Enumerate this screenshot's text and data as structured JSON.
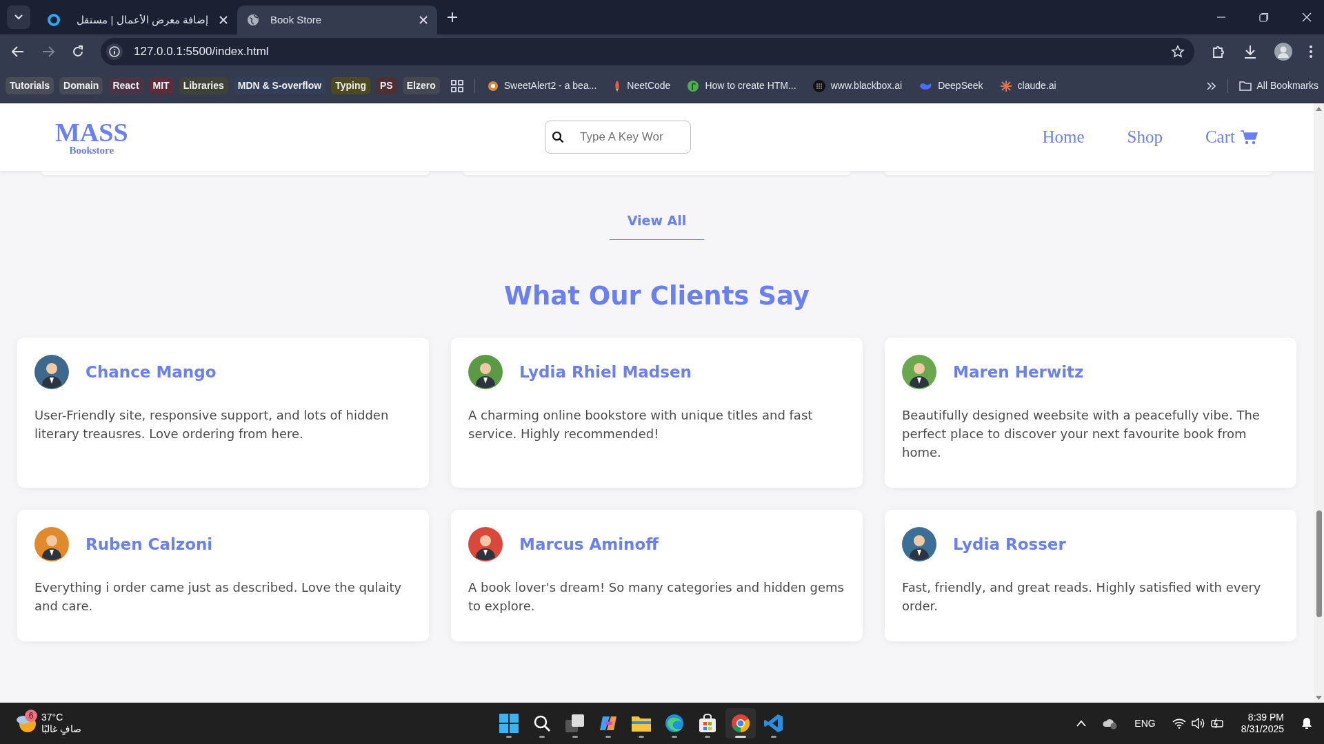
{
  "browser": {
    "tabs": [
      {
        "title": "إضافة معرض الأعمال | مستقل",
        "kind": "ring",
        "selected": false
      },
      {
        "title": "Book Store",
        "kind": "globe",
        "selected": true
      }
    ],
    "address": "127.0.0.1:5500/index.html",
    "bookmarks": [
      {
        "label": "Tutorials",
        "kind": "chip",
        "color": "#4a4d55"
      },
      {
        "label": "Domain",
        "kind": "chip",
        "color": "#474b55"
      },
      {
        "label": "React",
        "kind": "chip",
        "color": "#4b3446"
      },
      {
        "label": "MIT",
        "kind": "chip",
        "color": "#5a2c3c"
      },
      {
        "label": "Libraries",
        "kind": "chip",
        "color": "#3f4236"
      },
      {
        "label": "MDN & S-overflow",
        "kind": "chip",
        "color": "#333f59"
      },
      {
        "label": "Typing",
        "kind": "chip",
        "color": "#4b4a20"
      },
      {
        "label": "PS",
        "kind": "chip",
        "color": "#4e2f33"
      },
      {
        "label": "Elzero",
        "kind": "chip",
        "color": "#46484f"
      },
      {
        "label": "SweetAlert2 - a bea...",
        "kind": "spiral",
        "color": "#d98a3d"
      },
      {
        "label": "NeetCode",
        "kind": "rocket",
        "color": "#e85a4a"
      },
      {
        "label": "How to create HTM...",
        "kind": "leaf",
        "color": "#4caf50"
      },
      {
        "label": "www.blackbox.ai",
        "kind": "dots",
        "color": "#111111"
      },
      {
        "label": "DeepSeek",
        "kind": "whale",
        "color": "#4d6bfe"
      },
      {
        "label": "claude.ai",
        "kind": "burst",
        "color": "#d97757"
      }
    ],
    "all_bookmarks": "All Bookmarks"
  },
  "site": {
    "logo": "MASS",
    "logo_sub": "Bookstore",
    "search": {
      "placeholder": "Type A Key Wor"
    },
    "nav": [
      "Home",
      "Shop",
      "Cart"
    ],
    "view_all": "View All",
    "heading": "What Our Clients Say",
    "testimonials": [
      {
        "name": "Chance Mango",
        "text": "User-Friendly site, responsive support, and lots of hidden literary treausres. Love ordering from here.",
        "color": "#3d6a8c"
      },
      {
        "name": "Lydia Rhiel Madsen",
        "text": "A charming online bookstore with unique titles and fast service. Highly recommended!",
        "color": "#5a9a45"
      },
      {
        "name": "Maren Herwitz",
        "text": "Beautifully designed weebsite with a peacefully vibe. The perfect place to discover your next favourite book from home.",
        "color": "#6aa84f"
      },
      {
        "name": "Ruben Calzoni",
        "text": "Everything i order came just as described. Love the qulaity and care.",
        "color": "#e08a2c"
      },
      {
        "name": "Marcus Aminoff",
        "text": "A book lover's dream! So many categories and hidden gems to explore.",
        "color": "#d9483b"
      },
      {
        "name": "Lydia Rosser",
        "text": "Fast, friendly, and great reads. Highly satisfied with every order.",
        "color": "#3b6f96"
      }
    ]
  },
  "taskbar": {
    "weather": {
      "badge": "6",
      "temp": "37°C",
      "condition": "صافٍ غالبًا"
    },
    "apps": [
      {
        "kind": "windows",
        "selected": false
      },
      {
        "kind": "search",
        "selected": false
      },
      {
        "kind": "taskview",
        "selected": false
      },
      {
        "kind": "copilot",
        "selected": false
      },
      {
        "kind": "files",
        "selected": false
      },
      {
        "kind": "edge",
        "selected": false
      },
      {
        "kind": "store",
        "selected": false
      },
      {
        "kind": "chrome",
        "selected": true
      },
      {
        "kind": "vscode",
        "selected": false
      }
    ],
    "language": "ENG",
    "time": "8:39 PM",
    "date": "8/31/2025"
  }
}
